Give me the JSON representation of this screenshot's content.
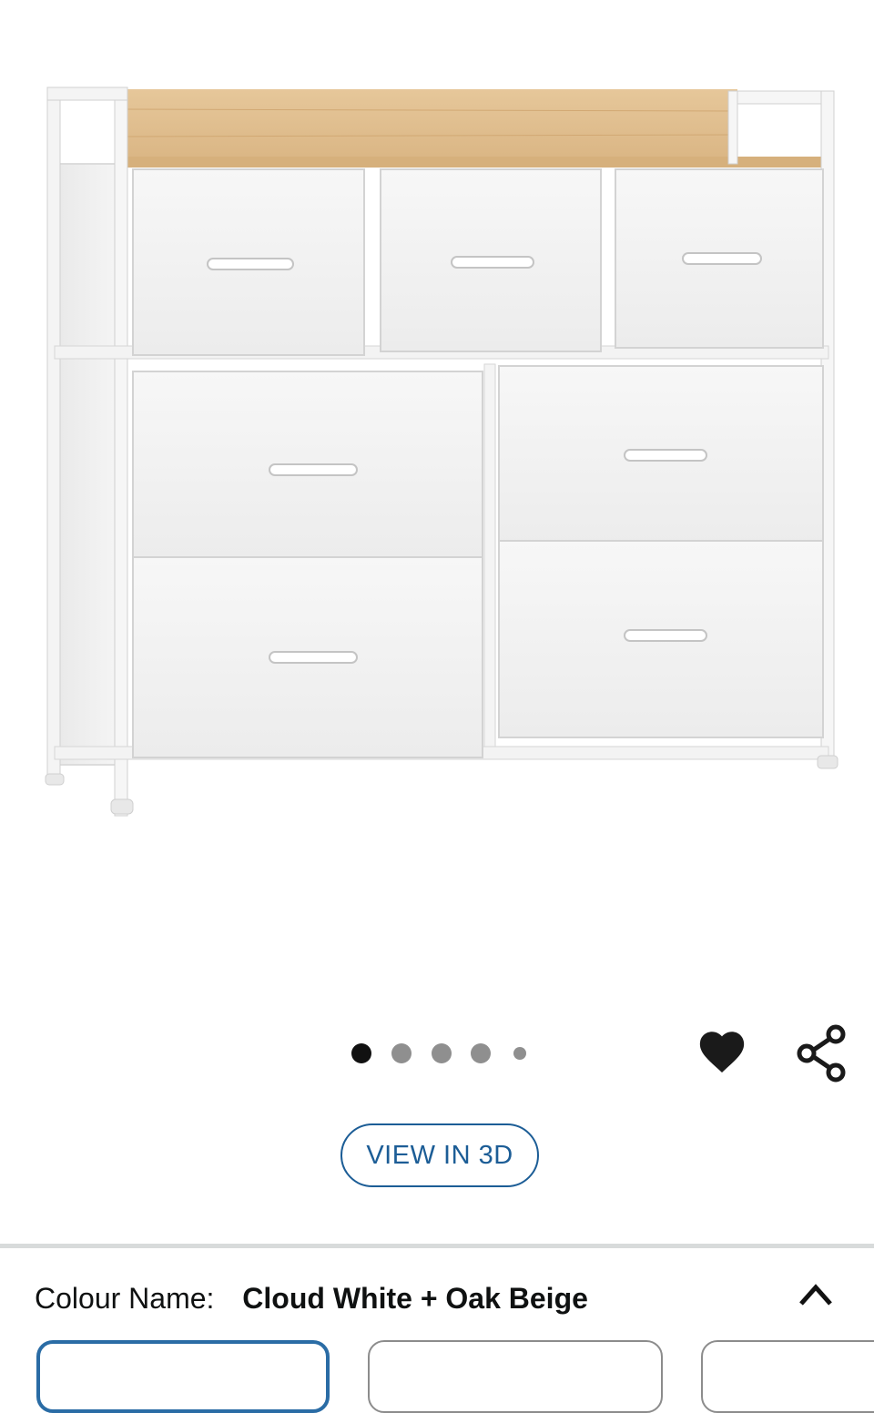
{
  "product": {
    "image_alt": "Fabric dresser with 7 drawers, white frame and oak beige top",
    "carousel": {
      "count": 5,
      "active_index": 0
    }
  },
  "actions": {
    "wishlist_icon": "heart-icon",
    "share_icon": "share-icon",
    "view_3d_label": "VIEW IN 3D"
  },
  "variation": {
    "label": "Colour Name:",
    "selected_value": "Cloud White + Oak Beige",
    "toggle_icon": "chevron-up-icon",
    "swatch_count": 3,
    "selected_swatch": 0
  },
  "colors": {
    "accent": "#1c5d96",
    "selected_border": "#2a6ca5",
    "swatch_border": "#8c8c8c",
    "divider": "#d8dbdb"
  }
}
